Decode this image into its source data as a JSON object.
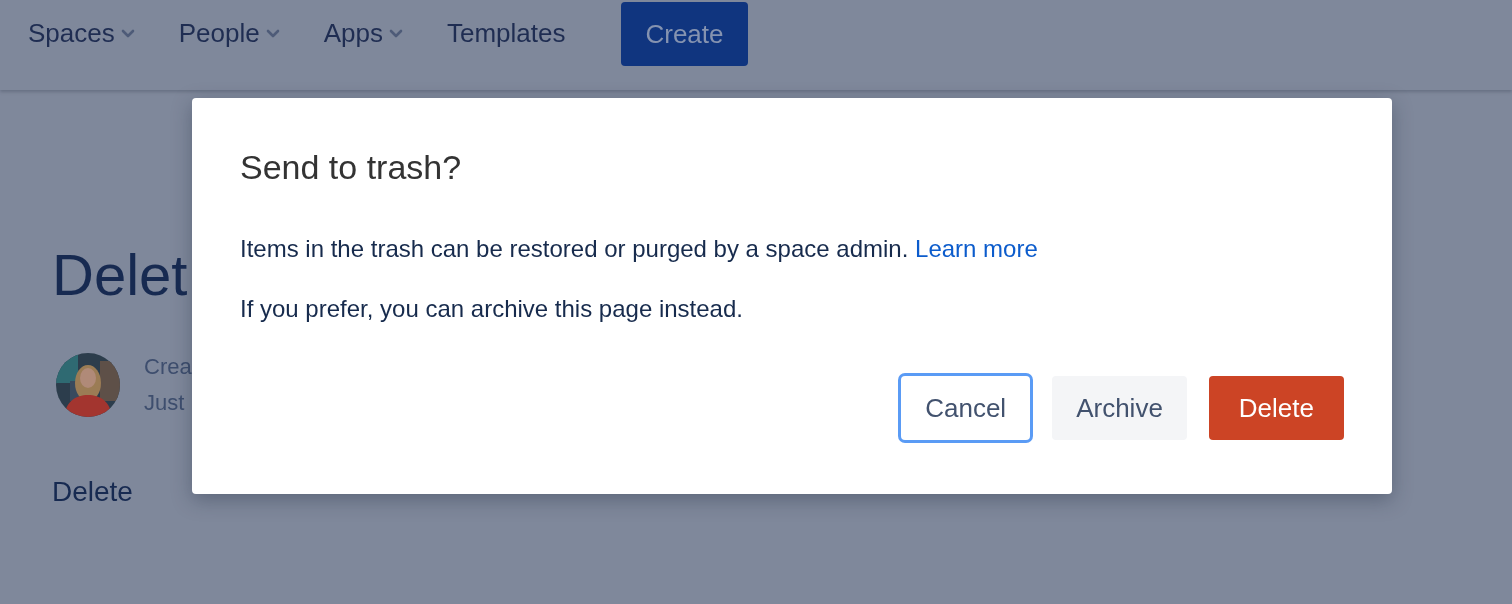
{
  "nav": {
    "items": [
      {
        "label": "Spaces",
        "dropdown": true
      },
      {
        "label": "People",
        "dropdown": true
      },
      {
        "label": "Apps",
        "dropdown": true
      },
      {
        "label": "Templates",
        "dropdown": false
      }
    ],
    "create_button": "Create"
  },
  "page": {
    "title": "Delet",
    "meta_line_1": "Crea",
    "meta_line_2": "Just",
    "body": "Delete"
  },
  "dialog": {
    "title": "Send to trash?",
    "message": "Items in the trash can be restored or purged by a space admin.",
    "link": "Learn more",
    "note": "If you prefer, you can archive this page instead.",
    "buttons": [
      {
        "label": "Cancel",
        "kind": "default",
        "focused": true
      },
      {
        "label": "Archive",
        "kind": "subtle",
        "focused": false
      },
      {
        "label": "Delete",
        "kind": "danger",
        "focused": false
      }
    ]
  }
}
